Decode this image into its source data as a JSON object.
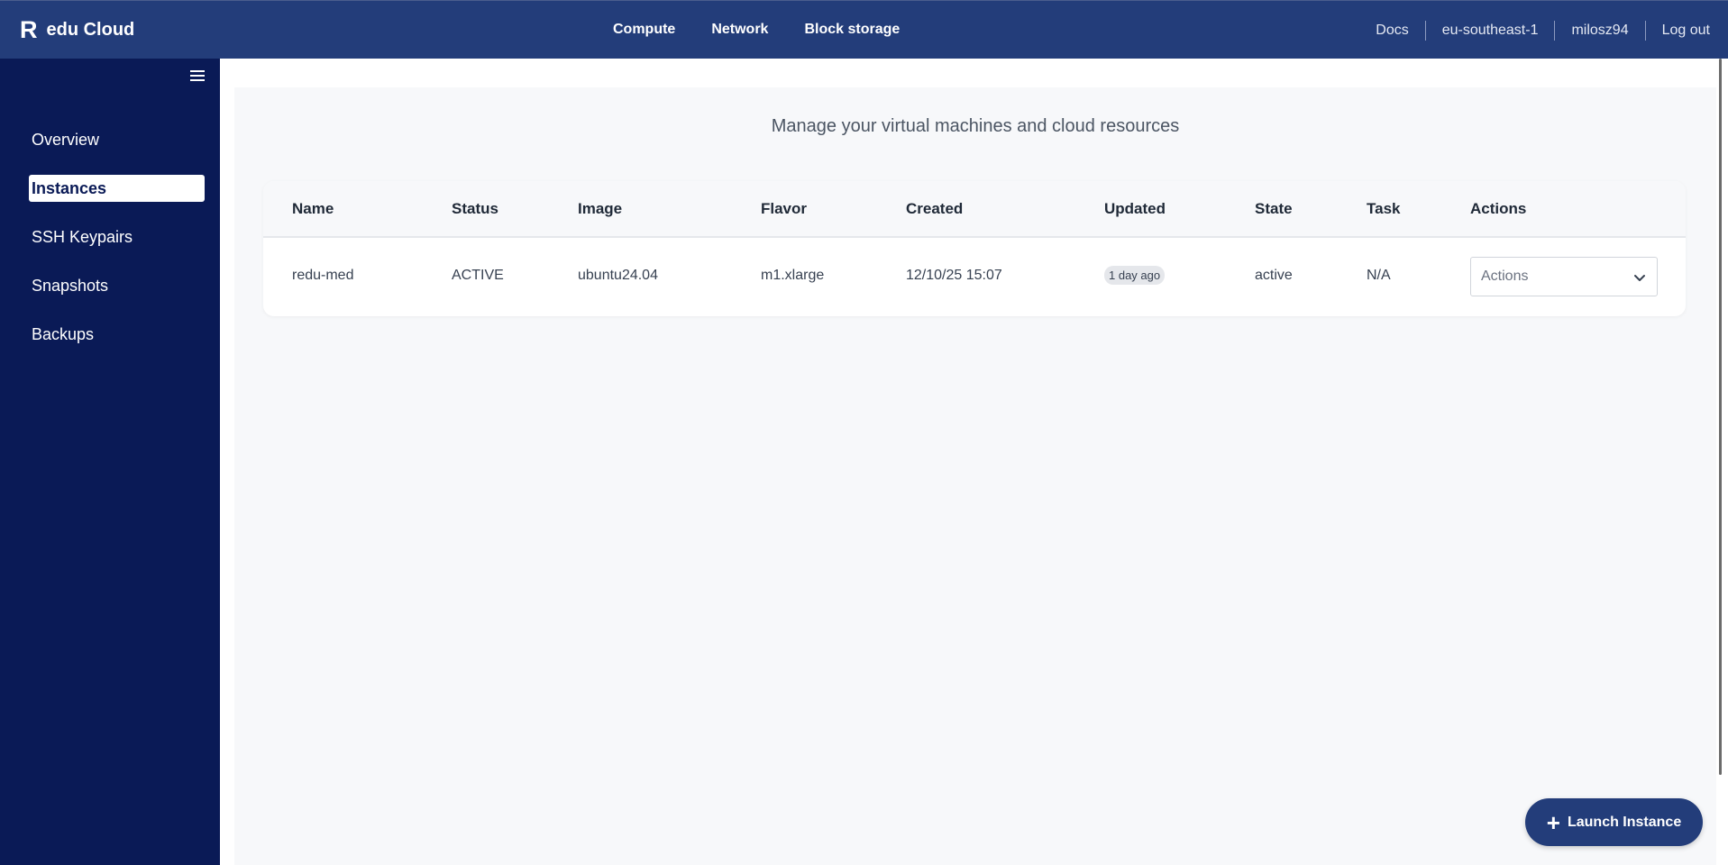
{
  "header": {
    "logo_letter": "R",
    "brand_name": "edu Cloud",
    "nav": [
      "Compute",
      "Network",
      "Block storage"
    ],
    "right": [
      "Docs",
      "eu-southeast-1",
      "milosz94",
      "Log out"
    ]
  },
  "sidebar": {
    "items": [
      {
        "label": "Overview",
        "active": false
      },
      {
        "label": "Instances",
        "active": true
      },
      {
        "label": "SSH Keypairs",
        "active": false
      },
      {
        "label": "Snapshots",
        "active": false
      },
      {
        "label": "Backups",
        "active": false
      }
    ]
  },
  "main": {
    "subtitle": "Manage your virtual machines and cloud resources",
    "table": {
      "columns": [
        "Name",
        "Status",
        "Image",
        "Flavor",
        "Created",
        "Updated",
        "State",
        "Task",
        "Actions"
      ],
      "rows": [
        {
          "name": "redu-med",
          "status": "ACTIVE",
          "image": "ubuntu24.04",
          "flavor": "m1.xlarge",
          "created": "12/10/25 15:07",
          "updated": "1 day ago",
          "state": "active",
          "task": "N/A",
          "actions_placeholder": "Actions"
        }
      ]
    },
    "launch_button": "Launch Instance"
  },
  "colors": {
    "topbar": "#233d7a",
    "sidebar": "#0a1a56",
    "panel": "#f7f8fa"
  }
}
